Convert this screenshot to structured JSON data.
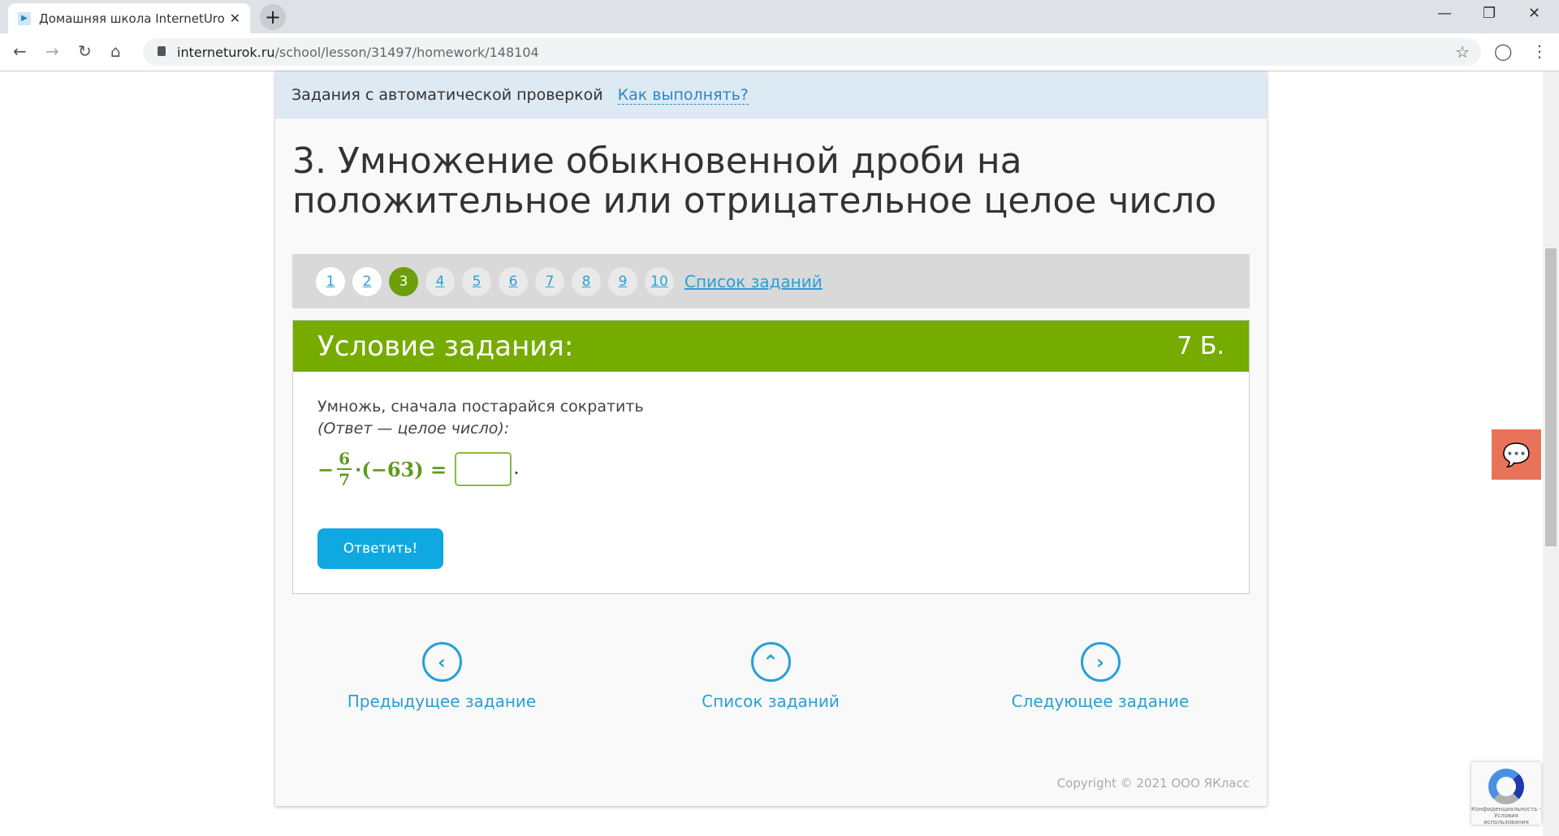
{
  "browser": {
    "tab_title": "Домашняя школа InternetUrok.ru",
    "url_domain": "interneturok.ru",
    "url_path": "/school/lesson/31497/homework/148104"
  },
  "page": {
    "top_strip": {
      "label": "Задания с автоматической проверкой",
      "help_link": "Как выполнять?"
    },
    "title": "3. Умножение обыкновенной дроби на положительное или отрицательное целое число",
    "pager": {
      "pages": [
        {
          "label": "1",
          "state": "done"
        },
        {
          "label": "2",
          "state": "done"
        },
        {
          "label": "3",
          "state": "current"
        },
        {
          "label": "4",
          "state": "todo"
        },
        {
          "label": "5",
          "state": "todo"
        },
        {
          "label": "6",
          "state": "todo"
        },
        {
          "label": "7",
          "state": "todo"
        },
        {
          "label": "8",
          "state": "todo"
        },
        {
          "label": "9",
          "state": "todo"
        },
        {
          "label": "10",
          "state": "todo"
        }
      ],
      "list_link": "Список заданий"
    },
    "task": {
      "header": "Условие задания:",
      "points": "7 Б.",
      "text": "Умножь, сначала постарайся сократить",
      "hint": "(Ответ — целое число):",
      "math": {
        "sign": "−",
        "numerator": "6",
        "denominator": "7",
        "rest": "·(−63) =",
        "end": "."
      },
      "answer_value": "",
      "submit": "Ответить!"
    },
    "nav": {
      "prev": "Предыдущее задание",
      "list": "Список заданий",
      "next": "Следующее задание"
    },
    "copyright": "Copyright © 2021 ООО ЯКласс",
    "recaptcha": "Конфиденциальность - Условия использования"
  },
  "colors": {
    "accent_green": "#76ab00",
    "link_blue": "#2a9fd6",
    "button": "#0fa8e0",
    "chat": "#e8735a"
  }
}
